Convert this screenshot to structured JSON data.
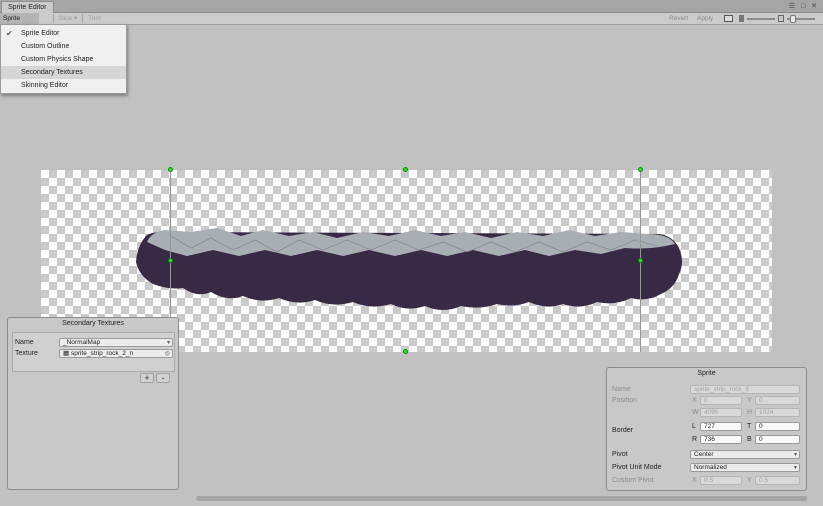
{
  "window": {
    "tab_title": "Sprite Editor",
    "controls": "☰ □ ✕"
  },
  "toolbar": {
    "mode_dropdown": "Sprite Editor",
    "slice_dropdown": "Slice",
    "trim_button": "Trim",
    "revert_button": "Revert",
    "apply_button": "Apply",
    "zoom_level": 0.68
  },
  "menu": {
    "items": [
      {
        "label": "Sprite Editor",
        "checked": true
      },
      {
        "label": "Custom Outline",
        "checked": false
      },
      {
        "label": "Custom Physics Shape",
        "checked": false
      },
      {
        "label": "Secondary Textures",
        "checked": false,
        "highlighted": true
      },
      {
        "label": "Skinning Editor",
        "checked": false
      }
    ]
  },
  "secondary_textures": {
    "title": "Secondary Textures",
    "name_label": "Name",
    "name_value": "_NormalMap",
    "texture_label": "Texture",
    "texture_value": "sprite_strip_rock_2_n",
    "add_button": "+",
    "remove_button": "-"
  },
  "sprite_panel": {
    "title": "Sprite",
    "name_label": "Name",
    "name_value": "sprite_strip_rock_3",
    "position_label": "Position",
    "x_label": "X",
    "x_value": "0",
    "y_label": "Y",
    "y_value": "0",
    "w_label": "W",
    "w_value": "4096",
    "h_label": "H",
    "h_value": "1024",
    "border_label": "Border",
    "l_label": "L",
    "l_value": "727",
    "t_label": "T",
    "t_value": "0",
    "r_label": "R",
    "r_value": "736",
    "b_label": "B",
    "b_value": "0",
    "pivot_label": "Pivot",
    "pivot_value": "Center",
    "pivot_unit_label": "Pivot Unit Mode",
    "pivot_unit_value": "Normalized",
    "custom_pivot_label": "Custom Pivot",
    "cp_x_label": "X",
    "cp_x_value": "0.5",
    "cp_y_label": "Y",
    "cp_y_value": "0.5"
  },
  "colors": {
    "sprite_fill": "#382a45",
    "sprite_top": "#a9aeb4",
    "handle": "#2de02d"
  }
}
